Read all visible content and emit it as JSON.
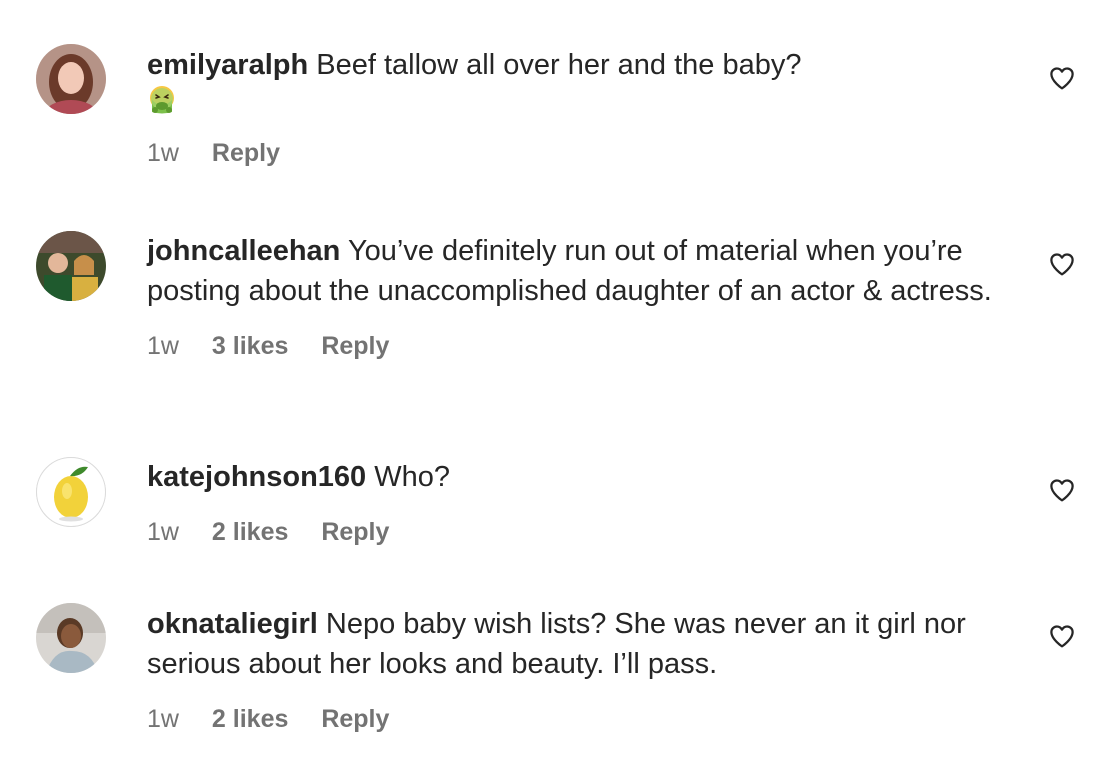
{
  "comments": [
    {
      "username": "emilyaralph",
      "text": "Beef tallow all over her and the baby?",
      "emoji": "nauseated-face",
      "time": "1w",
      "likes": "",
      "reply": "Reply"
    },
    {
      "username": "johncalleehan",
      "text": "You’ve definitely run out of material when you’re posting about the unaccomplished daughter of an actor & actress.",
      "time": "1w",
      "likes": "3 likes",
      "reply": "Reply"
    },
    {
      "username": "katejohnson160",
      "text": "Who?",
      "time": "1w",
      "likes": "2 likes",
      "reply": "Reply"
    },
    {
      "username": "oknataliegirl",
      "text": "Nepo baby wish lists? She was never an it girl nor serious about her looks and beauty. I’ll pass.",
      "time": "1w",
      "likes": "2 likes",
      "reply": "Reply"
    }
  ],
  "colors": {
    "text": "#262626",
    "meta": "#737373"
  },
  "icons": {
    "like": "heart-outline-icon"
  }
}
